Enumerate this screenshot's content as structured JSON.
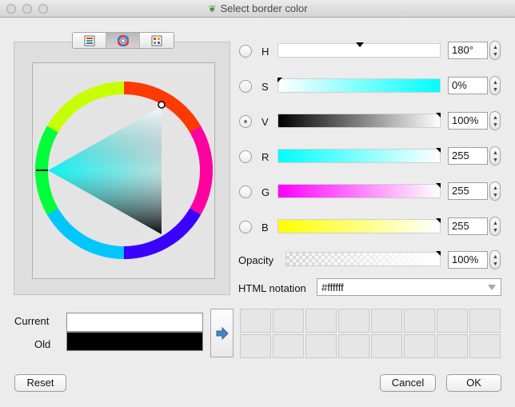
{
  "window": {
    "title": "Select border color"
  },
  "tabs": [
    {
      "name": "color-ramp-tab",
      "icon": "gradient-icon"
    },
    {
      "name": "color-wheel-tab",
      "icon": "color-wheel-icon",
      "active": true
    },
    {
      "name": "swatches-tab",
      "icon": "palette-grid-icon"
    }
  ],
  "channels": [
    {
      "key": "h",
      "label": "H",
      "value": "180°",
      "checked": false,
      "level": 0.5
    },
    {
      "key": "s",
      "label": "S",
      "value": "0%",
      "checked": false,
      "level": 0.0
    },
    {
      "key": "v",
      "label": "V",
      "value": "100%",
      "checked": true,
      "level": 1.0
    },
    {
      "key": "r",
      "label": "R",
      "value": "255",
      "checked": false,
      "level": 1.0
    },
    {
      "key": "g",
      "label": "G",
      "value": "255",
      "checked": false,
      "level": 1.0
    },
    {
      "key": "b",
      "label": "B",
      "value": "255",
      "checked": false,
      "level": 1.0
    }
  ],
  "opacity": {
    "label": "Opacity",
    "value": "100%",
    "level": 1.0
  },
  "html_notation": {
    "label": "HTML notation",
    "value": "#ffffff"
  },
  "preview": {
    "current_label": "Current",
    "old_label": "Old",
    "current_color": "#ffffff",
    "old_color": "#000000"
  },
  "buttons": {
    "reset": "Reset",
    "cancel": "Cancel",
    "ok": "OK"
  }
}
